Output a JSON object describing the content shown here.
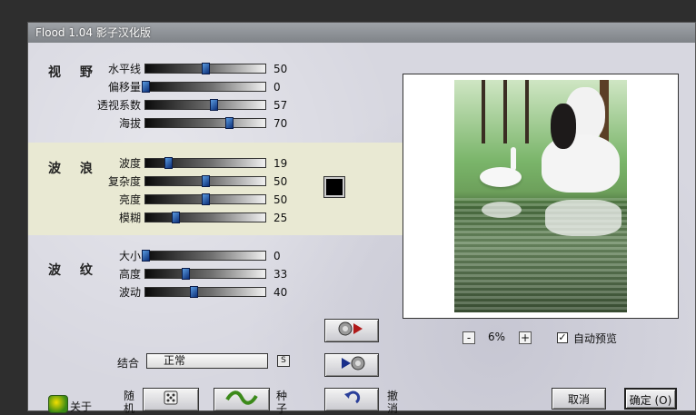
{
  "window": {
    "title": "Flood 1.04 影子汉化版"
  },
  "groups": {
    "view": {
      "title": "视 野",
      "rows": [
        {
          "label": "水平线",
          "value": "50",
          "fraction": 0.5
        },
        {
          "label": "偏移量",
          "value": "0",
          "fraction": 0.0
        },
        {
          "label": "透视系数",
          "value": "57",
          "fraction": 0.57
        },
        {
          "label": "海拔",
          "value": "70",
          "fraction": 0.7
        }
      ]
    },
    "wave": {
      "title": "波 浪",
      "rows": [
        {
          "label": "波度",
          "value": "19",
          "fraction": 0.19
        },
        {
          "label": "复杂度",
          "value": "50",
          "fraction": 0.5
        },
        {
          "label": "亮度",
          "value": "50",
          "fraction": 0.5
        },
        {
          "label": "模糊",
          "value": "25",
          "fraction": 0.25
        }
      ]
    },
    "ripple": {
      "title": "波 纹",
      "rows": [
        {
          "label": "大小",
          "value": "0",
          "fraction": 0.0
        },
        {
          "label": "高度",
          "value": "33",
          "fraction": 0.33
        },
        {
          "label": "波动",
          "value": "40",
          "fraction": 0.4
        }
      ]
    }
  },
  "wave_color": "#000000",
  "preview": {
    "zoom_text": "6%",
    "zoom_minus": "-",
    "zoom_plus": "+",
    "auto_preview_label": "自动预览",
    "auto_preview_checked": "✓"
  },
  "blend": {
    "label": "结合",
    "value": "正常",
    "mini_label": "S"
  },
  "bottom": {
    "about_label": "关于",
    "random_label": "随\n机",
    "seed_label": "种\n子",
    "undo_label": "撤\n消",
    "cancel_label": "取消",
    "ok_label": "确定 (O)"
  },
  "icons": {
    "logo": "flood-logo-icon",
    "play_forward": "play-forward-icon",
    "play_back": "play-back-icon",
    "dice": "dice-icon",
    "wave": "wave-icon",
    "undo": "undo-icon"
  }
}
